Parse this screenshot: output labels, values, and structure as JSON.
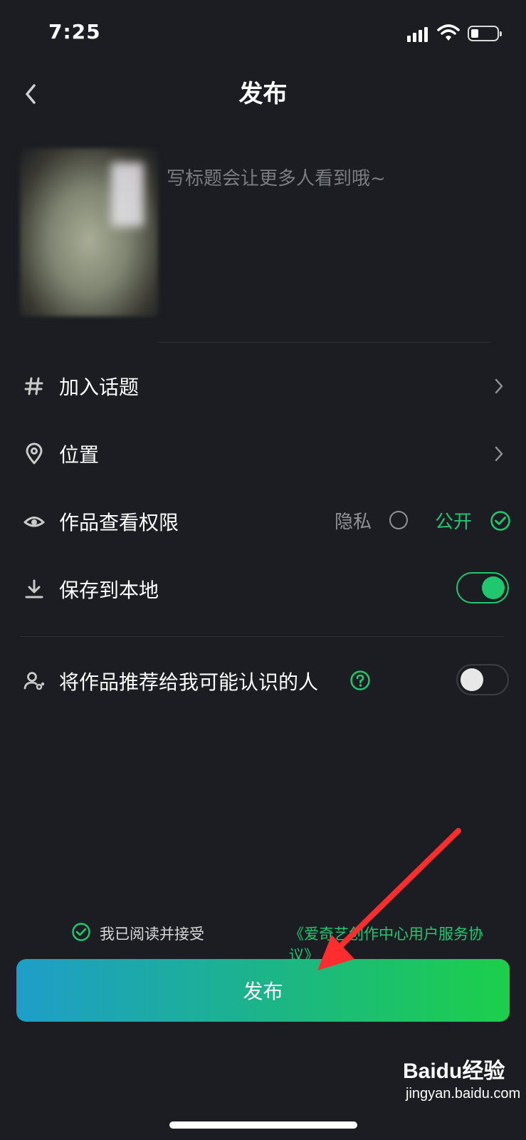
{
  "status_bar": {
    "time": "7:25"
  },
  "header": {
    "title": "发布"
  },
  "post": {
    "caption_placeholder": "写标题会让更多人看到哦~"
  },
  "rows": {
    "topic": {
      "label": "加入话题"
    },
    "location": {
      "label": "位置"
    },
    "permission": {
      "label": "作品查看权限",
      "private_label": "隐私",
      "public_label": "公开",
      "selected": "公开"
    },
    "save_local": {
      "label": "保存到本地",
      "enabled": true
    },
    "recommend": {
      "label": "将作品推荐给我可能认识的人",
      "enabled": false
    }
  },
  "agreement": {
    "prefix": "我已阅读并接受",
    "link": "《爱奇艺创作中心用户服务协议》",
    "checked": true
  },
  "publish_button": {
    "label": "发布"
  },
  "watermark": {
    "brand": "Baidu经验",
    "url": "jingyan.baidu.com"
  },
  "colors": {
    "background": "#1b1d22",
    "accent": "#1fc86e",
    "gradient_start": "#1e9ec9",
    "gradient_end": "#1ccf4a"
  },
  "icons": {
    "back": "chevron-left-icon",
    "topic": "hashtag-icon",
    "location": "location-pin-icon",
    "permission": "eye-icon",
    "save_local": "download-icon",
    "recommend": "person-link-icon",
    "help": "question-circle-icon",
    "chevron": "chevron-right-icon"
  }
}
